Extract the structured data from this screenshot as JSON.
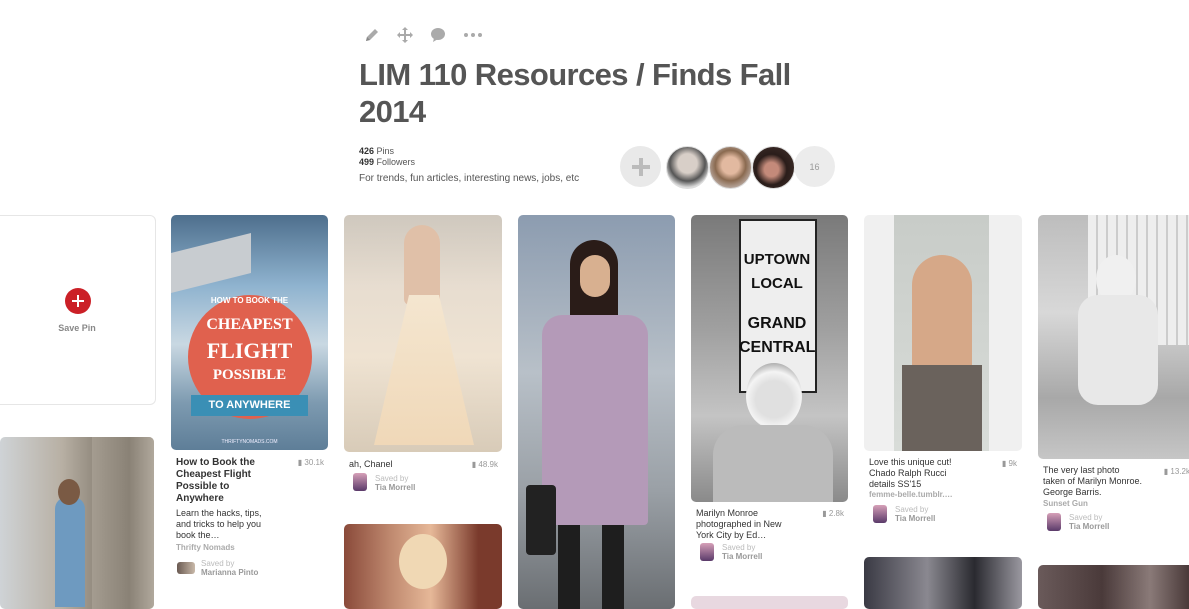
{
  "board": {
    "title": "LIM 110 Resources / Finds Fall 2014",
    "pins_count": "426",
    "pins_label": "Pins",
    "followers_count": "499",
    "followers_label": "Followers",
    "description": "For trends, fun articles, interesting news, jobs, etc",
    "collaborators_more": "16"
  },
  "toolbar": {
    "icons": [
      "pencil-icon",
      "move-icon",
      "comment-icon",
      "more-icon"
    ]
  },
  "save_pin": {
    "label": "Save Pin"
  },
  "pins": [
    {
      "description": "How to Book the Cheapest Flight Possible to Anywhere",
      "repins": "30.1k",
      "extra": "Learn the hacks, tips, and tricks to help you book the…",
      "source": "Thrifty Nomads",
      "saved_label": "Saved by",
      "saved_by": "Marianna Pinto",
      "image_text": {
        "top": "HOW TO BOOK THE",
        "line1": "CHEAPEST",
        "line2": "FLIGHT",
        "line3": "POSSIBLE",
        "ribbon": "TO ANYWHERE",
        "footer": "THRIFTYNOMADS.COM"
      }
    },
    {
      "description": "ah, Chanel",
      "repins": "48.9k",
      "saved_label": "Saved by",
      "saved_by": "Tia Morrell"
    },
    {
      "description": "",
      "repins": ""
    },
    {
      "description": "Marilyn Monroe photographed in New York City by Ed…",
      "repins": "2.8k",
      "saved_label": "Saved by",
      "saved_by": "Tia Morrell",
      "image_text": {
        "s1": "UPTOWN",
        "s2": "LOCAL",
        "s3": "GRAND",
        "s4": "CENTRAL"
      }
    },
    {
      "description": "Love this unique cut! Chado Ralph Rucci details SS'15",
      "repins": "9k",
      "source": "femme-belle.tumblr.…",
      "saved_label": "Saved by",
      "saved_by": "Tia Morrell"
    },
    {
      "description": "The very last photo taken of Marilyn Monroe. George Barris.",
      "repins": "13.2k",
      "source": "Sunset Gun",
      "saved_label": "Saved by",
      "saved_by": "Tia Morrell"
    }
  ],
  "colors": {
    "pinterest_red": "#cb2027",
    "title": "#555555"
  }
}
